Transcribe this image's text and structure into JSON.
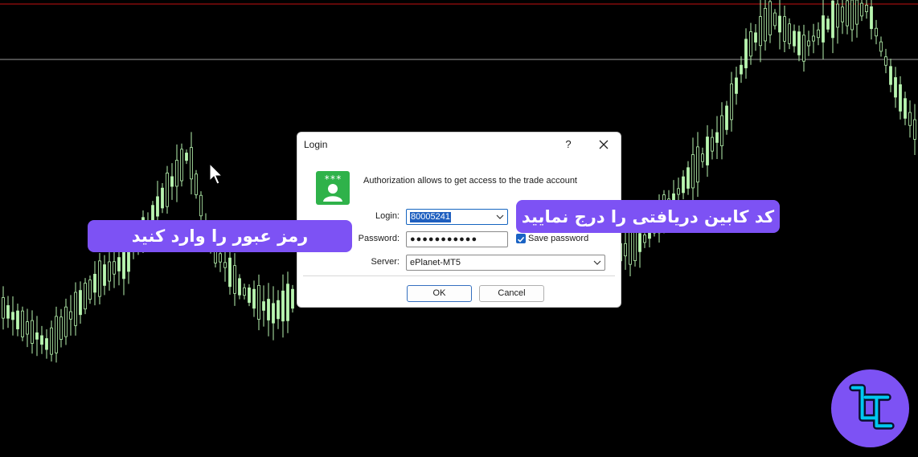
{
  "dialog": {
    "title": "Login",
    "help_label": "?",
    "description": "Authorization allows to get access to the trade account",
    "login": {
      "label": "Login:",
      "value": "80005241"
    },
    "password": {
      "label": "Password:",
      "value": "●●●●●●●●●●●",
      "save_label": "Save password",
      "save_checked": true
    },
    "server": {
      "label": "Server:",
      "value": "ePlanet-MT5"
    },
    "ok_label": "OK",
    "cancel_label": "Cancel"
  },
  "callouts": {
    "password": "رمز عبور را وارد کنید",
    "login": "کد کابین دریافتی را درج نمایید"
  },
  "colors": {
    "chart_background": "#000000",
    "candle": "#b8f5b0",
    "price_line_red": "#c41010",
    "price_line_grey": "#9a9a9a",
    "callout_bg": "#7d52f4",
    "icon_green": "#2fb24a",
    "accent_blue": "#1a63c4"
  },
  "icons": {
    "login_icon": "user-with-password-icon",
    "logo": "broker-logo-icon",
    "cursor": "mouse-pointer-icon"
  }
}
